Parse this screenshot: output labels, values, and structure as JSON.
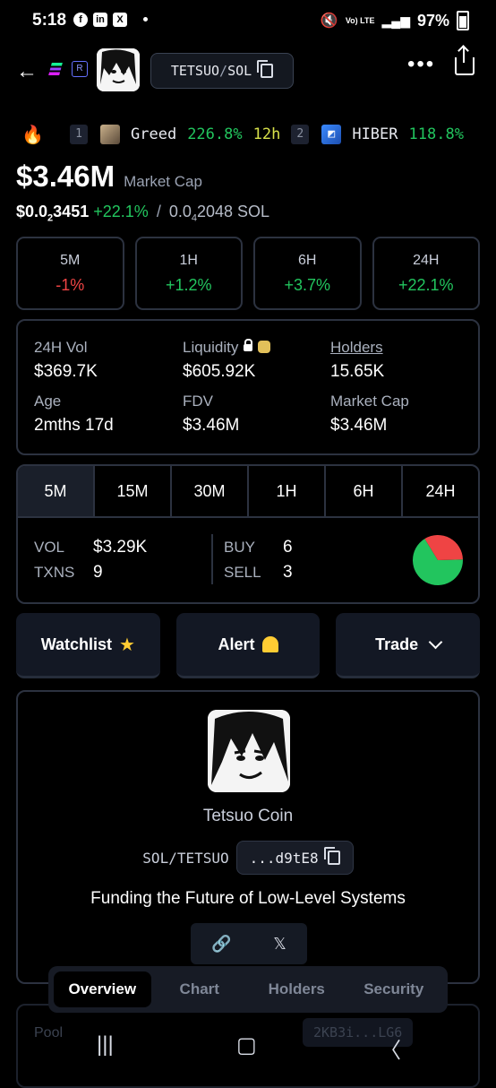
{
  "status_bar": {
    "time": "5:18",
    "notif_icons": [
      "f",
      "in",
      "X"
    ],
    "signal": "Vo) LTE",
    "battery": "97%"
  },
  "header": {
    "pair_base": "TETSUO",
    "pair_sep": "/",
    "pair_quote": "SOL",
    "more": "•••"
  },
  "trending": [
    {
      "rank": "1",
      "name": "Greed",
      "change": "226.8%",
      "period": "12h"
    },
    {
      "rank": "2",
      "name": "HIBER",
      "change": "118.8%"
    }
  ],
  "market": {
    "cap_value": "$3.46M",
    "cap_label": "Market Cap",
    "price_usd_prefix": "$0.0",
    "price_usd_sub": "2",
    "price_usd_rest": "3451",
    "price_change": "+22.1%",
    "price_sol_prefix": "0.0",
    "price_sol_sub": "4",
    "price_sol_rest": "2048 SOL"
  },
  "changes": [
    {
      "period": "5M",
      "value": "-1%",
      "dir": "down"
    },
    {
      "period": "1H",
      "value": "+1.2%",
      "dir": "up"
    },
    {
      "period": "6H",
      "value": "+3.7%",
      "dir": "up"
    },
    {
      "period": "24H",
      "value": "+22.1%",
      "dir": "up"
    }
  ],
  "stats": {
    "vol_label": "24H Vol",
    "vol_value": "$369.7K",
    "liq_label": "Liquidity",
    "liq_value": "$605.92K",
    "holders_label": "Holders",
    "holders_value": "15.65K",
    "age_label": "Age",
    "age_value": "2mths 17d",
    "fdv_label": "FDV",
    "fdv_value": "$3.46M",
    "mcap_label": "Market Cap",
    "mcap_value": "$3.46M"
  },
  "txn": {
    "tabs": [
      "5M",
      "15M",
      "30M",
      "1H",
      "6H",
      "24H"
    ],
    "vol_label": "VOL",
    "vol_value": "$3.29K",
    "txns_label": "TXNS",
    "txns_value": "9",
    "buy_label": "BUY",
    "buy_value": "6",
    "sell_label": "SELL",
    "sell_value": "3",
    "buy_count": 6,
    "sell_count": 3,
    "buy_color": "#22c55e",
    "sell_color": "#ef4444"
  },
  "actions": {
    "watchlist": "Watchlist",
    "alert": "Alert",
    "trade": "Trade"
  },
  "info": {
    "name": "Tetsuo Coin",
    "pair": "SOL/TETSUO",
    "address": "...d9tE8",
    "tagline": "Funding the Future of Low-Level Systems",
    "link_icon": "🔗",
    "x_icon": "𝕏"
  },
  "bottom_tabs": [
    "Overview",
    "Chart",
    "Holders",
    "Security"
  ],
  "pool": {
    "label": "Pool",
    "value": "2KB3i...LG6"
  }
}
